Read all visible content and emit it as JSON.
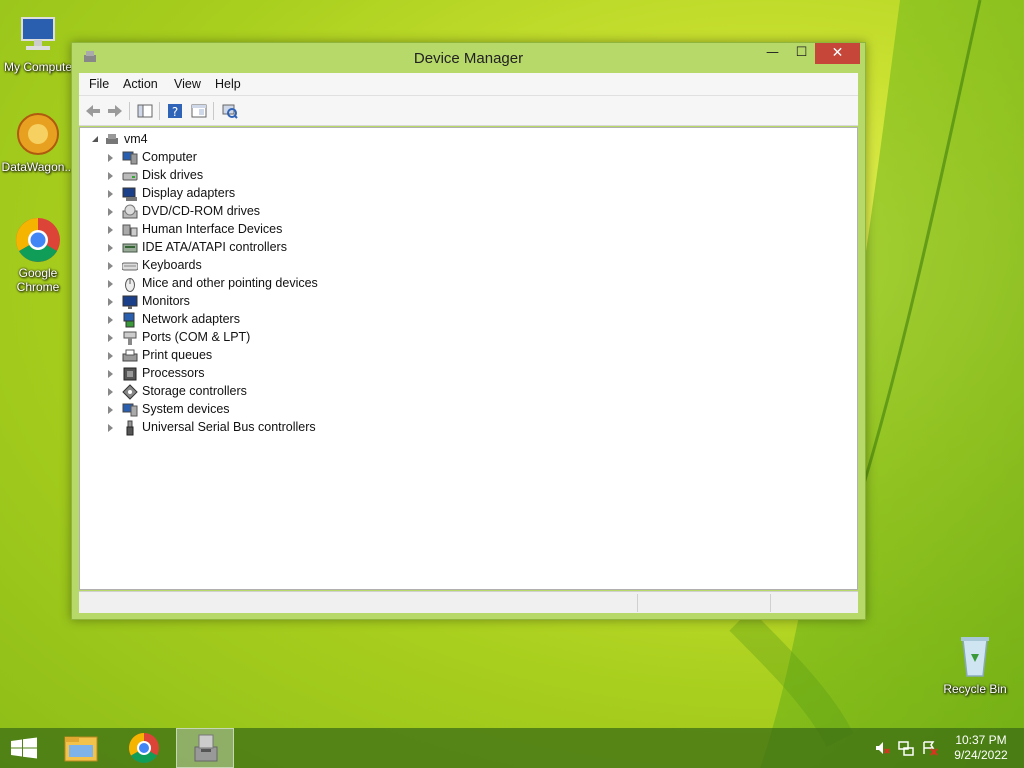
{
  "desktop": {
    "icons": [
      {
        "label": "My Compute",
        "icon": "computer-icon"
      },
      {
        "label": "DataWagon...",
        "icon": "datawagon-icon"
      },
      {
        "label": "Google Chrome",
        "icon": "chrome-icon"
      },
      {
        "label": "Recycle Bin",
        "icon": "recycle-bin-icon"
      }
    ]
  },
  "window": {
    "title": "Device Manager",
    "controls": {
      "minimize": "—",
      "maximize": "☐",
      "close": "✕"
    },
    "menu": [
      "File",
      "Action",
      "View",
      "Help"
    ],
    "toolbar": [
      "back-icon",
      "forward-icon",
      "show-hide-console-tree-icon",
      "help-icon",
      "properties-icon",
      "scan-hardware-icon"
    ],
    "tree": {
      "root": "vm4",
      "items": [
        {
          "label": "Computer",
          "icon": "computer-icon"
        },
        {
          "label": "Disk drives",
          "icon": "disk-drive-icon"
        },
        {
          "label": "Display adapters",
          "icon": "display-adapter-icon"
        },
        {
          "label": "DVD/CD-ROM drives",
          "icon": "dvd-drive-icon"
        },
        {
          "label": "Human Interface Devices",
          "icon": "hid-icon"
        },
        {
          "label": "IDE ATA/ATAPI controllers",
          "icon": "ide-controller-icon"
        },
        {
          "label": "Keyboards",
          "icon": "keyboard-icon"
        },
        {
          "label": "Mice and other pointing devices",
          "icon": "mouse-icon"
        },
        {
          "label": "Monitors",
          "icon": "monitor-icon"
        },
        {
          "label": "Network adapters",
          "icon": "network-adapter-icon"
        },
        {
          "label": "Ports (COM & LPT)",
          "icon": "port-icon"
        },
        {
          "label": "Print queues",
          "icon": "printer-icon"
        },
        {
          "label": "Processors",
          "icon": "processor-icon"
        },
        {
          "label": "Storage controllers",
          "icon": "storage-controller-icon"
        },
        {
          "label": "System devices",
          "icon": "system-device-icon"
        },
        {
          "label": "Universal Serial Bus controllers",
          "icon": "usb-icon"
        }
      ]
    }
  },
  "taskbar": {
    "items": [
      "start-icon",
      "file-explorer-icon",
      "chrome-icon",
      "device-manager-icon"
    ],
    "tray": [
      "volume-muted-icon",
      "network-icon",
      "action-center-icon"
    ],
    "time": "10:37 PM",
    "date": "9/24/2022"
  },
  "colors": {
    "close_button": "#c7463a",
    "window_frame": "#b7d96a",
    "taskbar": "#3c6e14"
  }
}
